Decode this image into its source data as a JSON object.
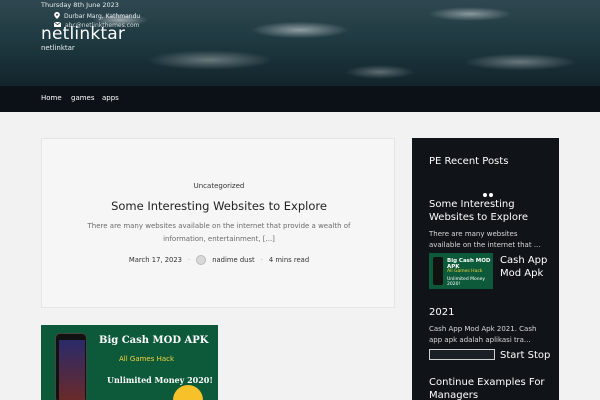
{
  "header": {
    "date": "Thursday 8th June 2023",
    "location": "Durbar Marg, Kathmandu",
    "email": "abc@netlinkthemes.com",
    "site_title": "netlinktar",
    "tagline": "netlinktar"
  },
  "nav": {
    "items": [
      "Home",
      "games",
      "apps"
    ]
  },
  "post": {
    "category": "Uncategorized",
    "title": "Some Interesting Websites to Explore",
    "excerpt": "There are many websites available on the internet that provide a wealth of information, entertainment, [...]",
    "date": "March 17, 2023",
    "author": "nadime dust",
    "read_time": "4 mins read"
  },
  "thumbnail": {
    "line1": "Big Cash MOD APK",
    "line2": "All Games Hack",
    "line3": "Unlimited Money 2020!"
  },
  "sidebar": {
    "title": "PE Recent Posts",
    "post1_title": "Some Interesting Websites to Explore",
    "post1_excerpt": "There are many websites available on the internet that ...",
    "thumb_line1": "Big Cash MOD APK",
    "thumb_line2": "All Games Hack",
    "thumb_line3": "Unlimited Money 2020!",
    "post2_title_a": "Cash App Mod Apk",
    "post2_title_b": "2021",
    "post2_excerpt": "Cash App Mod Apk 2021. Cash app apk adalah aplikasi tra...",
    "post3_title": "Start Stop",
    "post4_title": "Continue Examples For Managers"
  },
  "colors": {
    "header_bg": "#0f141c",
    "sidebar_bg": "#101419",
    "page_bg": "#f2f2f2",
    "thumb_green": "#0c5a3a",
    "accent_yellow": "#f5d33a"
  }
}
